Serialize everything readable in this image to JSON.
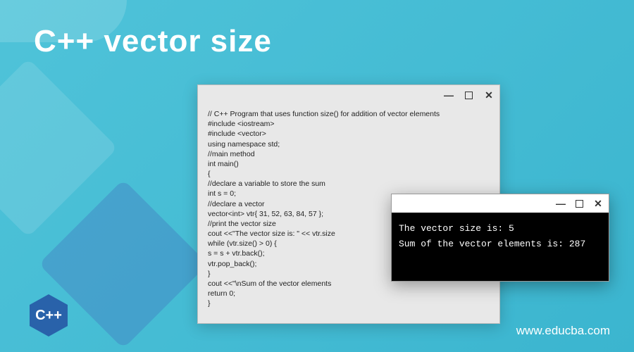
{
  "page": {
    "title": "C++ vector size",
    "footer_url": "www.educba.com"
  },
  "logo": {
    "text": "C++"
  },
  "code_window": {
    "lines": "// C++ Program that uses function size() for addition of vector elements\n#include <iostream>\n#include <vector>\nusing namespace std;\n//main method\nint main()\n{\n//declare a variable to store the sum\nint s = 0;\n//declare a vector\nvector<int> vtr{ 31, 52, 63, 84, 57 };\n//print the vector size\ncout <<\"The vector size is: \" << vtr.size\nwhile (vtr.size() > 0) {\ns = s + vtr.back();\nvtr.pop_back();\n}\ncout <<\"\\nSum of the vector elements\nreturn 0;\n}"
  },
  "console_window": {
    "output": "The vector size is: 5\nSum of the vector elements is: 287"
  }
}
